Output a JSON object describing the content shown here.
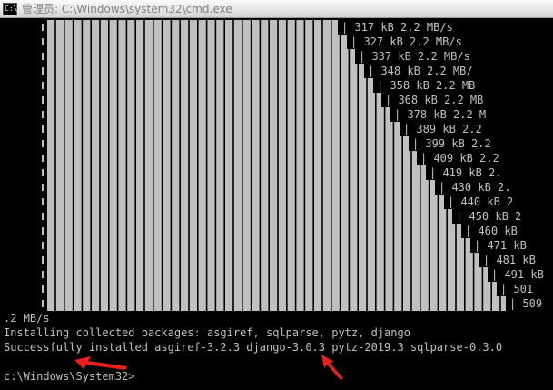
{
  "window": {
    "title": "管理员: C:\\Windows\\system32\\cmd.exe",
    "icon": "cmd-icon",
    "icon_text": "C:\\"
  },
  "progress_lines": [
    {
      "edge": 372,
      "text": "| 317 kB 2.2 MB/s"
    },
    {
      "edge": 382,
      "text": "| 327 kB 2.2 MB/s"
    },
    {
      "edge": 391,
      "text": "| 337 kB 2.2 MB/s"
    },
    {
      "edge": 401,
      "text": "| 348 kB 2.2 MB/"
    },
    {
      "edge": 411,
      "text": "| 358 kB 2.2 MB"
    },
    {
      "edge": 420,
      "text": "| 368 kB 2.2 MB"
    },
    {
      "edge": 430,
      "text": "| 378 kB 2.2 M"
    },
    {
      "edge": 440,
      "text": "| 389 kB 2.2"
    },
    {
      "edge": 450,
      "text": "| 399 kB 2.2"
    },
    {
      "edge": 459,
      "text": "| 409 kB 2.2"
    },
    {
      "edge": 469,
      "text": "| 419 kB 2."
    },
    {
      "edge": 479,
      "text": "| 430 kB 2."
    },
    {
      "edge": 489,
      "text": "| 440 kB 2"
    },
    {
      "edge": 498,
      "text": "| 450 kB 2"
    },
    {
      "edge": 508,
      "text": "| 460 kB"
    },
    {
      "edge": 518,
      "text": "| 471 kB"
    },
    {
      "edge": 528,
      "text": "| 481 kB"
    },
    {
      "edge": 537,
      "text": "| 491 kB"
    },
    {
      "edge": 547,
      "text": "| 501"
    },
    {
      "edge": 557,
      "text": "| 509"
    }
  ],
  "lines": {
    "speed_tail": ".2 MB/s",
    "installing": "Installing collected packages: asgiref, sqlparse, pytz, django",
    "success": "Successfully installed asgiref-3.2.3 django-3.0.3 pytz-2019.3 sqlparse-0.3.0",
    "prompt": "c:\\Windows\\System32>"
  },
  "colors": {
    "background": "#000000",
    "text": "#c0c0c0",
    "bar_fill": "#c0c0c0",
    "bar_gap": "#000000",
    "annotation_arrow": "#e8221b"
  }
}
